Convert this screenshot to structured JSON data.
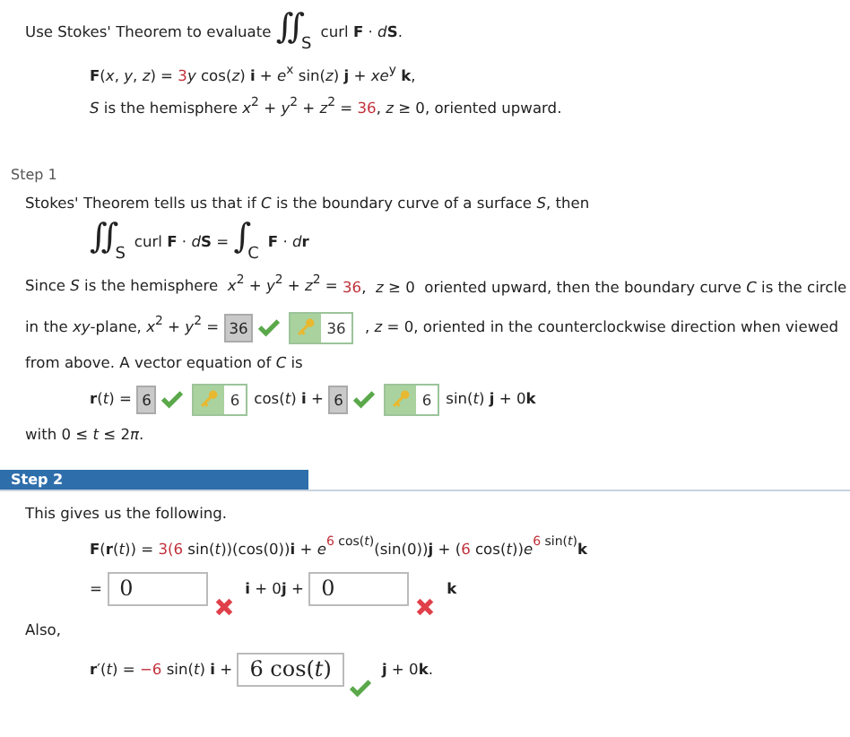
{
  "problem": [
    {
      "kind": "para",
      "segs": [
        {
          "kind": "text",
          "t": "Use Stokes' Theorem to evaluate "
        },
        {
          "kind": "int",
          "sign": "∬",
          "sub": "S"
        },
        {
          "kind": "text",
          "t": "curl **F** · *d*"
        },
        {
          "kind": "text",
          "t": "**S**."
        }
      ]
    },
    {
      "kind": "formula",
      "segs": [
        {
          "kind": "text",
          "t": "**F**(*x*, *y*, *z*) = "
        },
        {
          "kind": "red",
          "t": "3"
        },
        {
          "kind": "text",
          "t": "*y* cos(*z*) **i** + *e*$^{x}$ sin(*z*) **j** + *xe*$^{y}$ **k**,"
        }
      ]
    },
    {
      "kind": "formula",
      "segs": [
        {
          "kind": "text",
          "t": "*S* is the hemisphere *x*$^{2}$ + *y*$^{2}$ + *z*$^{2}$ = "
        },
        {
          "kind": "red",
          "t": "36"
        },
        {
          "kind": "text",
          "t": ", *z* ≥ 0, oriented upward."
        }
      ]
    }
  ],
  "steps": [
    {
      "title": "Step 1",
      "highlighted": false,
      "blocks": [
        {
          "kind": "para",
          "segs": [
            {
              "kind": "text",
              "t": "Stokes' Theorem tells us that if *C* is the boundary curve of a surface *S*, then"
            }
          ]
        },
        {
          "kind": "formula",
          "segs": [
            {
              "kind": "int",
              "sign": "∬",
              "sub": "S"
            },
            {
              "kind": "text",
              "t": "curl **F** · *d*"
            },
            {
              "kind": "text",
              "t": "**S** = "
            },
            {
              "kind": "int",
              "sign": "∫",
              "sub": "C"
            },
            {
              "kind": "text",
              "t": "**F** · *d*"
            },
            {
              "kind": "text",
              "t": "**r**"
            }
          ]
        },
        {
          "kind": "para",
          "segs": [
            {
              "kind": "text",
              "t": "Since *S* is the hemisphere  *x*$^{2}$ + *y*$^{2}$ + *z*$^{2}$ = "
            },
            {
              "kind": "red",
              "t": "36"
            },
            {
              "kind": "text",
              "t": ",  *z* ≥ 0  oriented upward, then the boundary curve *C* is the circle"
            }
          ]
        },
        {
          "kind": "para",
          "segs": [
            {
              "kind": "text",
              "t": "in the *xy*-plane, *x*$^{2}$ + *y*$^{2}$ = "
            },
            {
              "kind": "answer",
              "value": "36",
              "correct": true
            },
            {
              "kind": "key",
              "value": "36"
            },
            {
              "kind": "text",
              "t": " , *z* = 0, oriented in the counterclockwise direction when viewed"
            }
          ]
        },
        {
          "kind": "para",
          "segs": [
            {
              "kind": "text",
              "t": "from above. A vector equation of *C* is"
            }
          ]
        },
        {
          "kind": "formula",
          "segs": [
            {
              "kind": "text",
              "t": "**r**(*t*) = "
            },
            {
              "kind": "answer",
              "value": "6",
              "correct": true
            },
            {
              "kind": "key",
              "value": "6"
            },
            {
              "kind": "text",
              "t": "cos(*t*) **i** + "
            },
            {
              "kind": "answer",
              "value": "6",
              "correct": true
            },
            {
              "kind": "key",
              "value": "6"
            },
            {
              "kind": "text",
              "t": "sin(*t*) **j** + 0**k**"
            }
          ]
        },
        {
          "kind": "para",
          "segs": [
            {
              "kind": "text",
              "t": "with 0 ≤ *t* ≤ 2"
            },
            {
              "kind": "text",
              "t": "*π*."
            }
          ]
        }
      ]
    },
    {
      "title": "Step 2",
      "highlighted": true,
      "blocks": [
        {
          "kind": "para",
          "segs": [
            {
              "kind": "text",
              "t": "This gives us the following."
            }
          ]
        },
        {
          "kind": "formula",
          "segs": [
            {
              "kind": "text",
              "t": "**F**(**r**(*t*)) = "
            },
            {
              "kind": "red",
              "t": "3(6"
            },
            {
              "kind": "text",
              "t": " sin(*t*))(cos(0))**i** + *e*"
            },
            {
              "kind": "sup_red",
              "t": "6"
            },
            {
              "kind": "sup",
              "t": " cos(*t*)"
            },
            {
              "kind": "text",
              "t": "(sin(0))**j** + ("
            },
            {
              "kind": "red",
              "t": "6"
            },
            {
              "kind": "text",
              "t": " cos(*t*))*e*"
            },
            {
              "kind": "sup_red",
              "t": "6"
            },
            {
              "kind": "sup",
              "t": " sin(*t*)"
            },
            {
              "kind": "text",
              "t": "**k**"
            }
          ]
        },
        {
          "kind": "formula",
          "segs": [
            {
              "kind": "text",
              "t": "= "
            },
            {
              "kind": "input",
              "value": "0",
              "correct": false
            },
            {
              "kind": "text",
              "t": "**i** + 0**j** + "
            },
            {
              "kind": "input",
              "value": "0",
              "correct": false
            },
            {
              "kind": "text",
              "t": "**k**"
            }
          ]
        },
        {
          "kind": "para",
          "segs": [
            {
              "kind": "text",
              "t": "Also,"
            }
          ]
        },
        {
          "kind": "formula",
          "segs": [
            {
              "kind": "text",
              "t": "**r**′(*t*) = "
            },
            {
              "kind": "red",
              "t": "−6"
            },
            {
              "kind": "text",
              "t": " sin(*t*) **i** + "
            },
            {
              "kind": "input",
              "value": "6 cos(*t*)",
              "correct": true
            },
            {
              "kind": "text",
              "t": "**j** + 0**k**."
            }
          ]
        }
      ]
    }
  ]
}
